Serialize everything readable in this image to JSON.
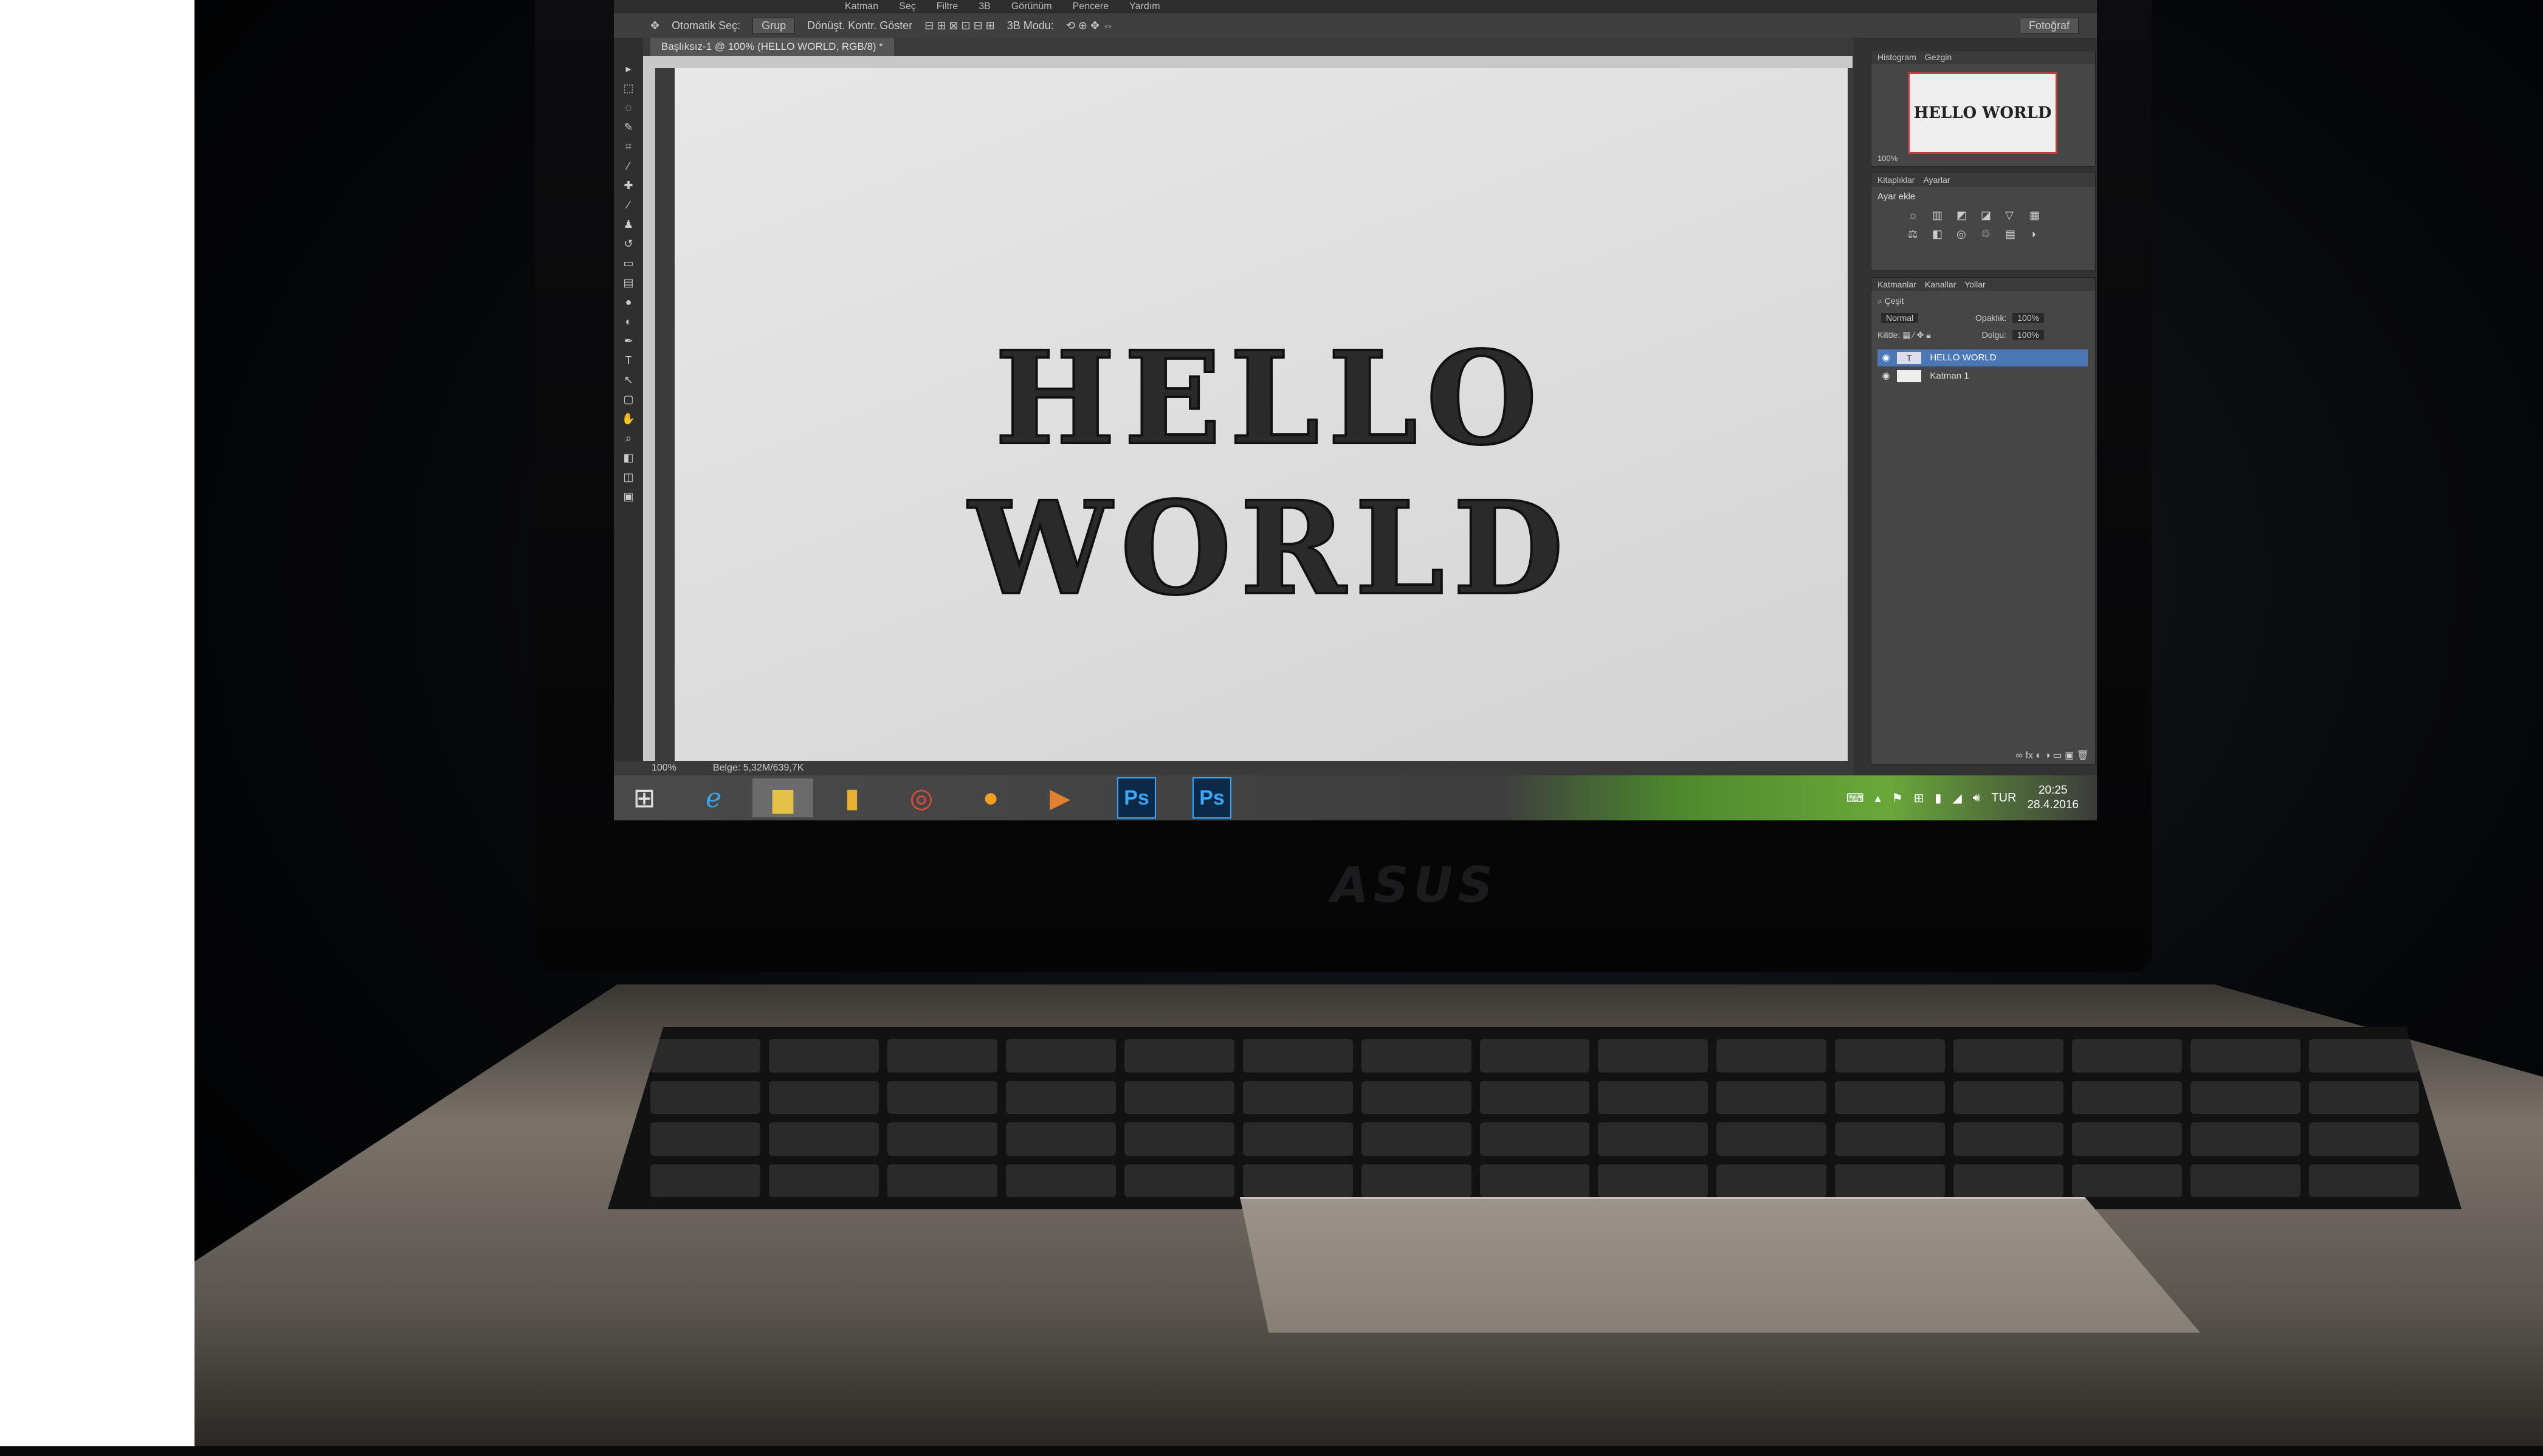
{
  "photoshop": {
    "menu": [
      "Katman",
      "Seç",
      "Filtre",
      "3B",
      "Görünüm",
      "Pencere",
      "Yardım"
    ],
    "options": {
      "auto_select": "Otomatik Seç:",
      "group": "Grup",
      "transform_controls": "Dönüşt. Kontr. Göster",
      "mode_3d": "3B Modu:"
    },
    "document_tab": "Başlıksız-1 @ 100% (HELLO WORLD, RGB/8) *",
    "workspace": "Fotoğraf",
    "canvas_text": "HELLO WORLD",
    "status": {
      "zoom": "100%",
      "doc_size": "Belge: 5,32M/639,7K"
    },
    "panels": {
      "navigator_tabs": [
        "Histogram",
        "Gezgin"
      ],
      "navigator_zoom": "100%",
      "adjust_tabs": [
        "Kitaplıklar",
        "Ayarlar"
      ],
      "adjust_title": "Ayar ekle",
      "layers_tabs": [
        "Katmanlar",
        "Kanallar",
        "Yollar"
      ],
      "filter_kind": "Çeşit",
      "blend_mode": "Normal",
      "opacity_label": "Opaklık:",
      "opacity_value": "100%",
      "lock_label": "Kilitle:",
      "fill_label": "Dolgu:",
      "fill_value": "100%",
      "layers": [
        {
          "name": "HELLO WORLD",
          "selected": true
        },
        {
          "name": "Katman 1",
          "selected": false
        }
      ]
    }
  },
  "taskbar": {
    "apps": [
      "start-icon",
      "internet-explorer-icon",
      "file-explorer-icon",
      "folder-icon",
      "chrome-icon",
      "cloud-app-icon",
      "media-player-icon",
      "photoshop-icon",
      "photoshop-icon"
    ],
    "ps_label": "Ps",
    "language": "TUR",
    "time": "20:25",
    "date": "28.4.2016"
  },
  "brand": "ASUS",
  "colors": {
    "selected_layer": "#4b78b4",
    "taskbar_green": "#6aa83a"
  }
}
